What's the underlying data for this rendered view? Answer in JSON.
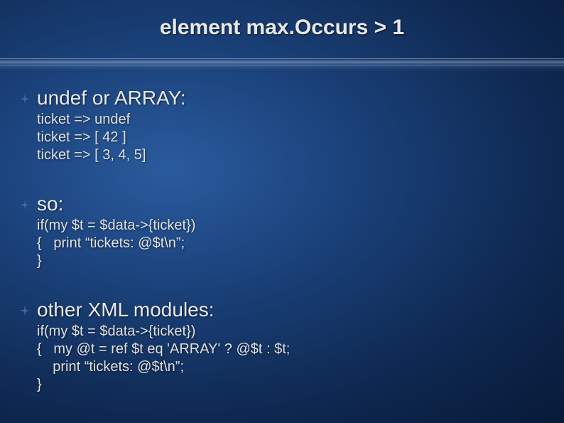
{
  "title": "element max.Occurs > 1",
  "sections": [
    {
      "heading": "undef or ARRAY:",
      "code": "ticket => undef\nticket => [ 42 ]\nticket => [ 3, 4, 5]"
    },
    {
      "heading": "so:",
      "code": "if(my $t = $data->{ticket})\n{   print “tickets: @$t\\n”;\n}"
    },
    {
      "heading": "other XML modules:",
      "code": "if(my $t = $data->{ticket})\n{   my @t = ref $t eq 'ARRAY' ? @$t : $t;\n    print “tickets: @$t\\n”;\n}"
    }
  ]
}
